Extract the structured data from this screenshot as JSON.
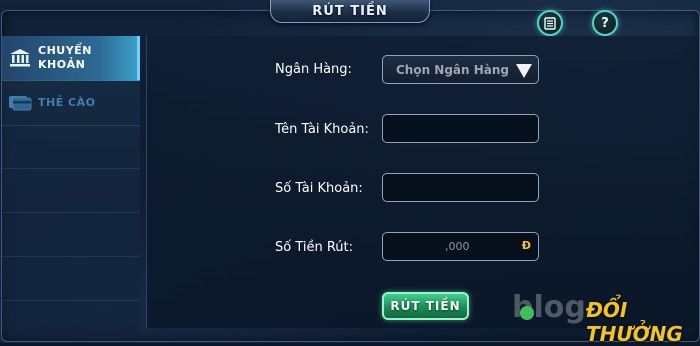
{
  "header": {
    "title": "RÚT TIỀN",
    "icons": [
      "notes-icon",
      "help-icon"
    ],
    "help_glyph": "?"
  },
  "sidebar": {
    "items": [
      {
        "label": "CHUYỂN\nKHOẢN",
        "icon": "bank-icon",
        "active": true
      },
      {
        "label": "THẺ CÀO",
        "icon": "card-icon",
        "active": false
      }
    ]
  },
  "form": {
    "bank_label": "Ngân Hàng:",
    "bank_select": "Chọn Ngân Hàng",
    "account_name_label": "Tên Tài Khoản:",
    "account_name_value": "",
    "account_number_label": "Số Tài Khoản:",
    "account_number_value": "",
    "amount_label": "Số Tiền Rút:",
    "amount_value": ",000",
    "currency_symbol": "Đ",
    "submit_label": "RÚT TIỀN"
  },
  "watermark": {
    "blog": "blog",
    "brand": "ĐỔI THƯỞNG"
  },
  "colors": {
    "accent": "#4fd6c7",
    "submit": "#1a8f57",
    "currency": "#f3c133",
    "brand": "#f4c421"
  }
}
